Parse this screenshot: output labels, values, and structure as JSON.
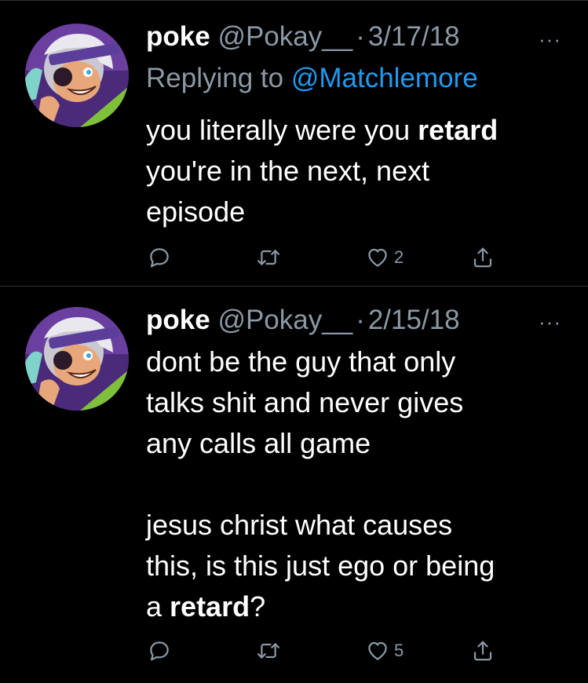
{
  "colors": {
    "background": "#000000",
    "divider": "#2f3336",
    "secondary_text": "#8b98a5",
    "link": "#1d9bf0"
  },
  "tweets": [
    {
      "name": "poke",
      "handle": "@Pokay__",
      "separator": "·",
      "date": "3/17/18",
      "more": "···",
      "replying_prefix": "Replying to",
      "replying_to": "@Matchlemore",
      "lines": [
        {
          "pre": "you literally were you ",
          "bold": "retard",
          "post": ""
        },
        {
          "pre": "you're in the next, next",
          "bold": "",
          "post": ""
        },
        {
          "pre": "episode",
          "bold": "",
          "post": ""
        }
      ],
      "actions": {
        "reply_icon": "reply-icon",
        "retweet_icon": "retweet-icon",
        "like_icon": "heart-icon",
        "like_count": "2",
        "share_icon": "share-icon"
      }
    },
    {
      "name": "poke",
      "handle": "@Pokay__",
      "separator": "·",
      "date": "2/15/18",
      "more": "···",
      "lines": [
        {
          "pre": "dont be the guy that only",
          "bold": "",
          "post": ""
        },
        {
          "pre": "talks shit and never gives",
          "bold": "",
          "post": ""
        },
        {
          "pre": "any calls all game",
          "bold": "",
          "post": ""
        },
        {
          "pre": "",
          "bold": "",
          "post": ""
        },
        {
          "pre": "jesus christ what causes",
          "bold": "",
          "post": ""
        },
        {
          "pre": "this, is this just ego or being",
          "bold": "",
          "post": ""
        },
        {
          "pre": "a ",
          "bold": "retard",
          "post": "?"
        }
      ],
      "actions": {
        "reply_icon": "reply-icon",
        "retweet_icon": "retweet-icon",
        "like_icon": "heart-icon",
        "like_count": "5",
        "share_icon": "share-icon"
      }
    }
  ]
}
